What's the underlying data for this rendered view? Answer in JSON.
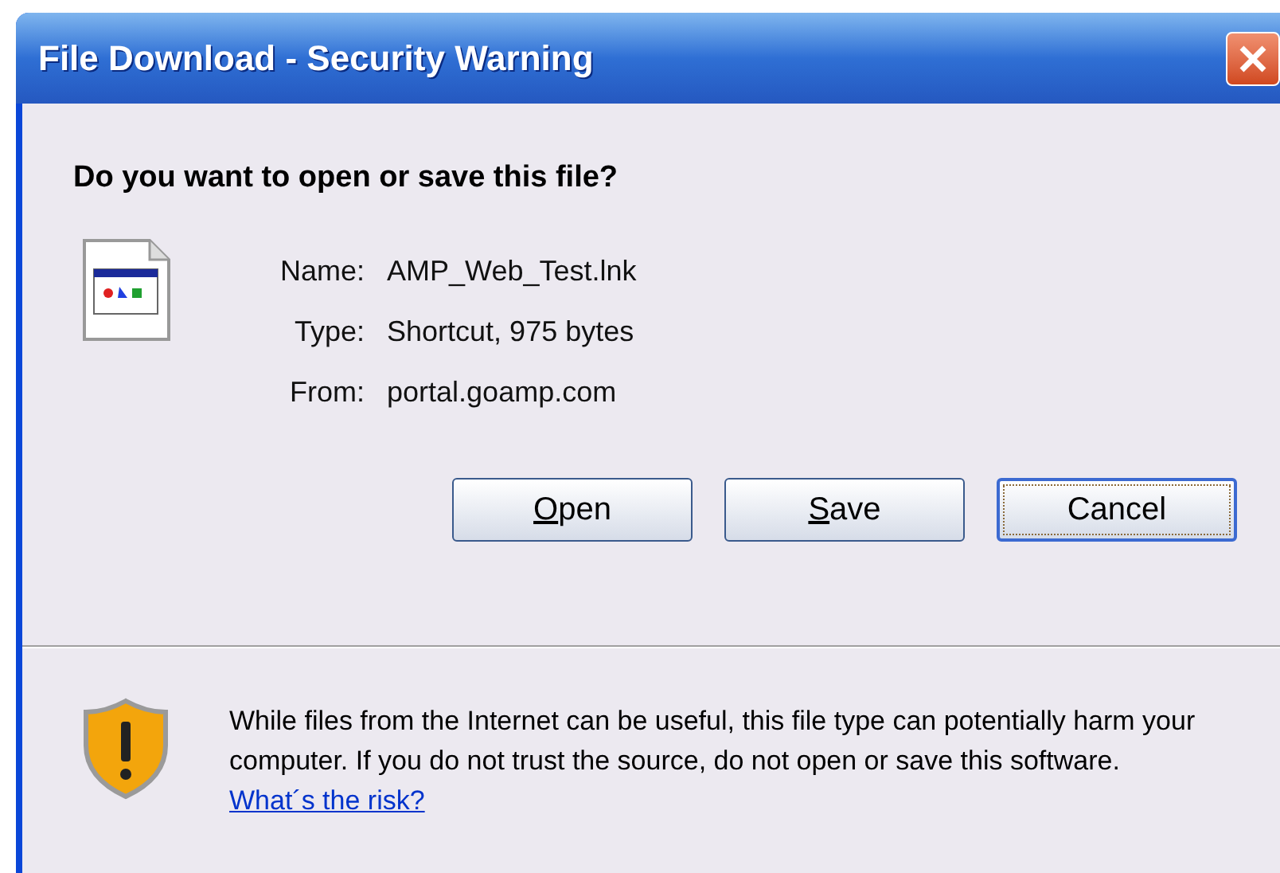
{
  "window": {
    "title": "File Download - Security Warning"
  },
  "question": "Do you want to open or save this file?",
  "details": [
    {
      "label": "Name:",
      "value": "AMP_Web_Test.lnk"
    },
    {
      "label": "Type:",
      "value": "Shortcut, 975 bytes"
    },
    {
      "label": "From:",
      "value": "portal.goamp.com"
    }
  ],
  "buttons": [
    {
      "label": "Open",
      "underline_first": true,
      "default": false
    },
    {
      "label": "Save",
      "underline_first": true,
      "default": false
    },
    {
      "label": "Cancel",
      "underline_first": false,
      "default": true
    }
  ],
  "warning": {
    "text": "While files from the Internet can be useful, this file type can potentially harm your computer. If you do not trust the source, do not open or save this software.",
    "link": "What´s the risk?"
  }
}
